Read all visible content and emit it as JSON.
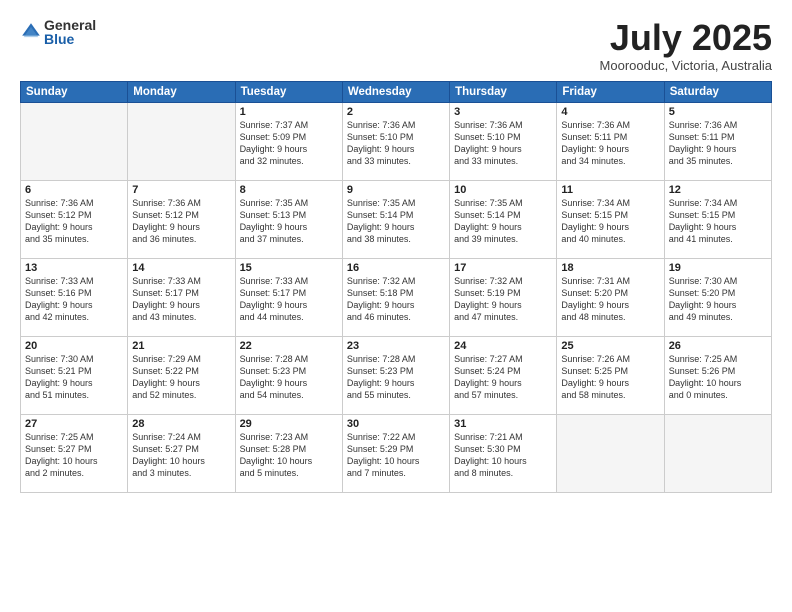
{
  "logo": {
    "general": "General",
    "blue": "Blue"
  },
  "title": "July 2025",
  "location": "Moorooduc, Victoria, Australia",
  "days_header": [
    "Sunday",
    "Monday",
    "Tuesday",
    "Wednesday",
    "Thursday",
    "Friday",
    "Saturday"
  ],
  "weeks": [
    [
      {
        "day": "",
        "info": ""
      },
      {
        "day": "",
        "info": ""
      },
      {
        "day": "1",
        "info": "Sunrise: 7:37 AM\nSunset: 5:09 PM\nDaylight: 9 hours\nand 32 minutes."
      },
      {
        "day": "2",
        "info": "Sunrise: 7:36 AM\nSunset: 5:10 PM\nDaylight: 9 hours\nand 33 minutes."
      },
      {
        "day": "3",
        "info": "Sunrise: 7:36 AM\nSunset: 5:10 PM\nDaylight: 9 hours\nand 33 minutes."
      },
      {
        "day": "4",
        "info": "Sunrise: 7:36 AM\nSunset: 5:11 PM\nDaylight: 9 hours\nand 34 minutes."
      },
      {
        "day": "5",
        "info": "Sunrise: 7:36 AM\nSunset: 5:11 PM\nDaylight: 9 hours\nand 35 minutes."
      }
    ],
    [
      {
        "day": "6",
        "info": "Sunrise: 7:36 AM\nSunset: 5:12 PM\nDaylight: 9 hours\nand 35 minutes."
      },
      {
        "day": "7",
        "info": "Sunrise: 7:36 AM\nSunset: 5:12 PM\nDaylight: 9 hours\nand 36 minutes."
      },
      {
        "day": "8",
        "info": "Sunrise: 7:35 AM\nSunset: 5:13 PM\nDaylight: 9 hours\nand 37 minutes."
      },
      {
        "day": "9",
        "info": "Sunrise: 7:35 AM\nSunset: 5:14 PM\nDaylight: 9 hours\nand 38 minutes."
      },
      {
        "day": "10",
        "info": "Sunrise: 7:35 AM\nSunset: 5:14 PM\nDaylight: 9 hours\nand 39 minutes."
      },
      {
        "day": "11",
        "info": "Sunrise: 7:34 AM\nSunset: 5:15 PM\nDaylight: 9 hours\nand 40 minutes."
      },
      {
        "day": "12",
        "info": "Sunrise: 7:34 AM\nSunset: 5:15 PM\nDaylight: 9 hours\nand 41 minutes."
      }
    ],
    [
      {
        "day": "13",
        "info": "Sunrise: 7:33 AM\nSunset: 5:16 PM\nDaylight: 9 hours\nand 42 minutes."
      },
      {
        "day": "14",
        "info": "Sunrise: 7:33 AM\nSunset: 5:17 PM\nDaylight: 9 hours\nand 43 minutes."
      },
      {
        "day": "15",
        "info": "Sunrise: 7:33 AM\nSunset: 5:17 PM\nDaylight: 9 hours\nand 44 minutes."
      },
      {
        "day": "16",
        "info": "Sunrise: 7:32 AM\nSunset: 5:18 PM\nDaylight: 9 hours\nand 46 minutes."
      },
      {
        "day": "17",
        "info": "Sunrise: 7:32 AM\nSunset: 5:19 PM\nDaylight: 9 hours\nand 47 minutes."
      },
      {
        "day": "18",
        "info": "Sunrise: 7:31 AM\nSunset: 5:20 PM\nDaylight: 9 hours\nand 48 minutes."
      },
      {
        "day": "19",
        "info": "Sunrise: 7:30 AM\nSunset: 5:20 PM\nDaylight: 9 hours\nand 49 minutes."
      }
    ],
    [
      {
        "day": "20",
        "info": "Sunrise: 7:30 AM\nSunset: 5:21 PM\nDaylight: 9 hours\nand 51 minutes."
      },
      {
        "day": "21",
        "info": "Sunrise: 7:29 AM\nSunset: 5:22 PM\nDaylight: 9 hours\nand 52 minutes."
      },
      {
        "day": "22",
        "info": "Sunrise: 7:28 AM\nSunset: 5:23 PM\nDaylight: 9 hours\nand 54 minutes."
      },
      {
        "day": "23",
        "info": "Sunrise: 7:28 AM\nSunset: 5:23 PM\nDaylight: 9 hours\nand 55 minutes."
      },
      {
        "day": "24",
        "info": "Sunrise: 7:27 AM\nSunset: 5:24 PM\nDaylight: 9 hours\nand 57 minutes."
      },
      {
        "day": "25",
        "info": "Sunrise: 7:26 AM\nSunset: 5:25 PM\nDaylight: 9 hours\nand 58 minutes."
      },
      {
        "day": "26",
        "info": "Sunrise: 7:25 AM\nSunset: 5:26 PM\nDaylight: 10 hours\nand 0 minutes."
      }
    ],
    [
      {
        "day": "27",
        "info": "Sunrise: 7:25 AM\nSunset: 5:27 PM\nDaylight: 10 hours\nand 2 minutes."
      },
      {
        "day": "28",
        "info": "Sunrise: 7:24 AM\nSunset: 5:27 PM\nDaylight: 10 hours\nand 3 minutes."
      },
      {
        "day": "29",
        "info": "Sunrise: 7:23 AM\nSunset: 5:28 PM\nDaylight: 10 hours\nand 5 minutes."
      },
      {
        "day": "30",
        "info": "Sunrise: 7:22 AM\nSunset: 5:29 PM\nDaylight: 10 hours\nand 7 minutes."
      },
      {
        "day": "31",
        "info": "Sunrise: 7:21 AM\nSunset: 5:30 PM\nDaylight: 10 hours\nand 8 minutes."
      },
      {
        "day": "",
        "info": ""
      },
      {
        "day": "",
        "info": ""
      }
    ]
  ]
}
